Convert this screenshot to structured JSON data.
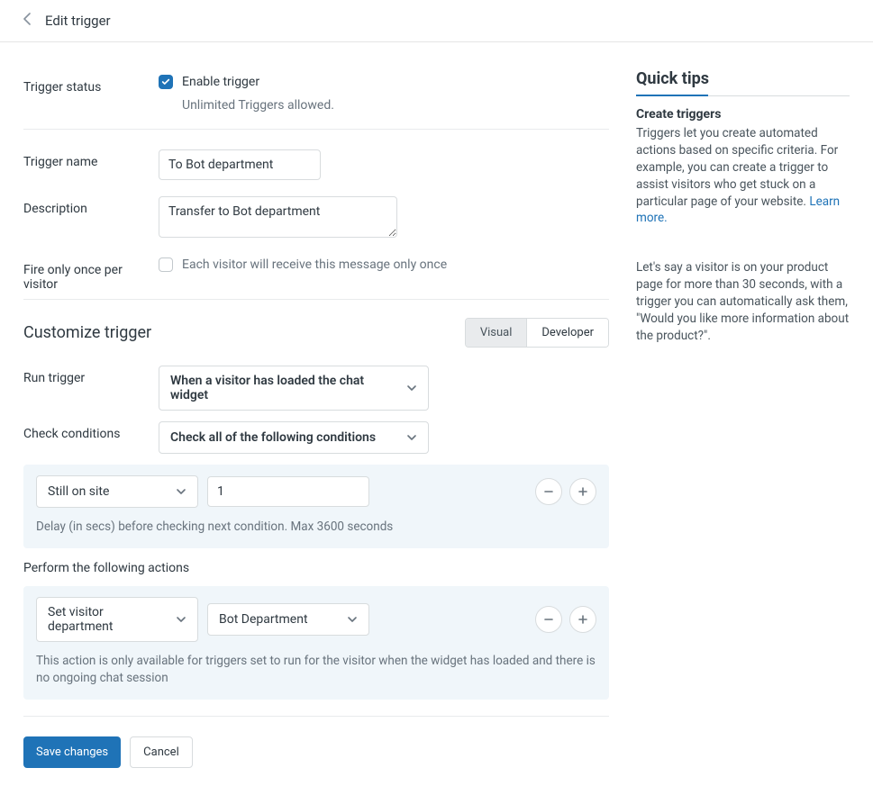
{
  "header": {
    "title": "Edit trigger"
  },
  "form": {
    "status_label": "Trigger status",
    "enable_label": "Enable trigger",
    "status_hint": "Unlimited Triggers allowed.",
    "name_label": "Trigger name",
    "name_value": "To Bot department",
    "desc_label": "Description",
    "desc_value": "Transfer to Bot department",
    "fire_once_label": "Fire only once per visitor",
    "fire_once_hint": "Each visitor will receive this message only once"
  },
  "customize": {
    "title": "Customize trigger",
    "tabs": {
      "visual": "Visual",
      "developer": "Developer"
    },
    "run_label": "Run trigger",
    "run_value": "When a visitor has loaded the chat widget",
    "check_label": "Check conditions",
    "check_value": "Check all of the following conditions",
    "condition": {
      "type": "Still on site",
      "value": "1",
      "hint": "Delay (in secs) before checking next condition. Max 3600 seconds"
    },
    "perform_label": "Perform the following actions",
    "action": {
      "type": "Set visitor department",
      "value": "Bot Department",
      "hint": "This action is only available for triggers set to run for the visitor when the widget has loaded and there is no ongoing chat session"
    }
  },
  "footer": {
    "save": "Save changes",
    "cancel": "Cancel"
  },
  "tips": {
    "heading": "Quick tips",
    "sub": "Create triggers",
    "p1": "Triggers let you create automated actions based on specific criteria. For example, you can create a trigger to assist visitors who get stuck on a particular page of your website.",
    "learn": "Learn more.",
    "p2": "Let's say a visitor is on your product page for more than 30 seconds, with a trigger you can automatically ask them, \"Would you like more information about the product?\"."
  }
}
